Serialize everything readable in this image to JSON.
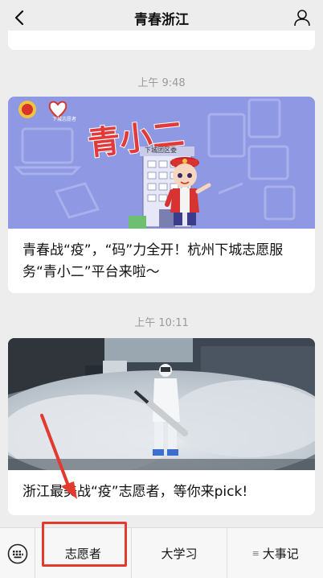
{
  "header": {
    "title": "青春浙江",
    "back_icon": "chevron-left-icon",
    "profile_icon": "user-icon"
  },
  "messages": [
    {
      "time": "上午 9:48",
      "caption": "青春战“疫”，“码”力全开！杭州下城志愿服务“青小二”平台来啦～",
      "cover": {
        "headline": "青小二",
        "building_sign": "下城团区委",
        "logo_text": "下城志愿者"
      }
    },
    {
      "time": "上午 10:11",
      "caption": "浙江最美战“疫”志愿者，等你来pick!"
    }
  ],
  "bottom_bar": {
    "keyboard_icon": "keyboard-icon",
    "menus": [
      "志愿者",
      "大学习",
      "大事记"
    ]
  },
  "colors": {
    "background": "#ededed",
    "annotation_red": "#e23a2e",
    "poster_blue": "#8f98e3"
  }
}
